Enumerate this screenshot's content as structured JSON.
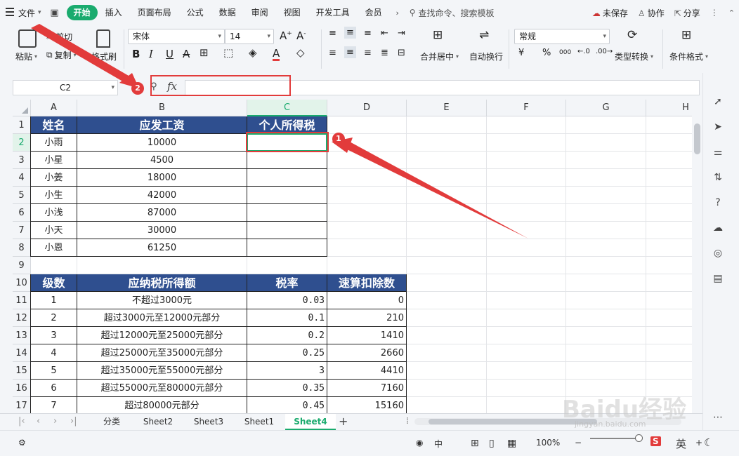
{
  "menubar": {
    "file_label": "文件",
    "tabs": [
      "开始",
      "插入",
      "页面布局",
      "公式",
      "数据",
      "审阅",
      "视图",
      "开发工具",
      "会员"
    ],
    "active_tab": "开始",
    "search_placeholder": "查找命令、搜索模板",
    "unsaved": "未保存",
    "collab": "协作",
    "share": "分享"
  },
  "ribbon": {
    "paste": "粘贴",
    "cut": "剪切",
    "copy": "复制",
    "format_painter": "格式刷",
    "font_name": "宋体",
    "font_size": "14",
    "merge_center": "合并居中",
    "wrap_text": "自动换行",
    "number_format": "常规",
    "type_convert": "类型转换",
    "cond_format": "条件格式",
    "currency": "¥",
    "percent": "%",
    "thousands": "000"
  },
  "formula_bar": {
    "name_box": "C2",
    "fx": "fx",
    "content": ""
  },
  "columns": [
    "A",
    "B",
    "C",
    "D",
    "E",
    "F",
    "G",
    "H"
  ],
  "selected_column": "C",
  "rows": [
    "1",
    "2",
    "3",
    "4",
    "5",
    "6",
    "7",
    "8",
    "9",
    "10",
    "11",
    "12",
    "13",
    "14",
    "15",
    "16",
    "17"
  ],
  "selected_row": "2",
  "table1": {
    "headers": [
      "姓名",
      "应发工资",
      "个人所得税"
    ],
    "rows": [
      [
        "小雨",
        "10000",
        ""
      ],
      [
        "小星",
        "4500",
        ""
      ],
      [
        "小姜",
        "18000",
        ""
      ],
      [
        "小生",
        "42000",
        ""
      ],
      [
        "小浅",
        "87000",
        ""
      ],
      [
        "小天",
        "30000",
        ""
      ],
      [
        "小恩",
        "61250",
        ""
      ]
    ]
  },
  "table2": {
    "headers": [
      "级数",
      "应纳税所得额",
      "税率",
      "速算扣除数"
    ],
    "rows": [
      [
        "1",
        "不超过3000元",
        "0.03",
        "0"
      ],
      [
        "2",
        "超过3000元至12000元部分",
        "0.1",
        "210"
      ],
      [
        "3",
        "超过12000元至25000元部分",
        "0.2",
        "1410"
      ],
      [
        "4",
        "超过25000元至35000元部分",
        "0.25",
        "2660"
      ],
      [
        "5",
        "超过35000元至55000元部分",
        "3",
        "4410"
      ],
      [
        "6",
        "超过55000元至80000元部分",
        "0.35",
        "7160"
      ],
      [
        "7",
        "超过80000元部分",
        "0.45",
        "15160"
      ]
    ]
  },
  "sheets": [
    "分类",
    "Sheet2",
    "Sheet3",
    "Sheet1",
    "Sheet4"
  ],
  "active_sheet": "Sheet4",
  "status": {
    "zoom": "100%"
  },
  "annotations": {
    "badge1": "1",
    "badge2": "2",
    "color": "#e23b3b"
  },
  "watermark": {
    "main": "Baidu经验",
    "url": "jingyan.baidu.com"
  },
  "input_method": "英"
}
